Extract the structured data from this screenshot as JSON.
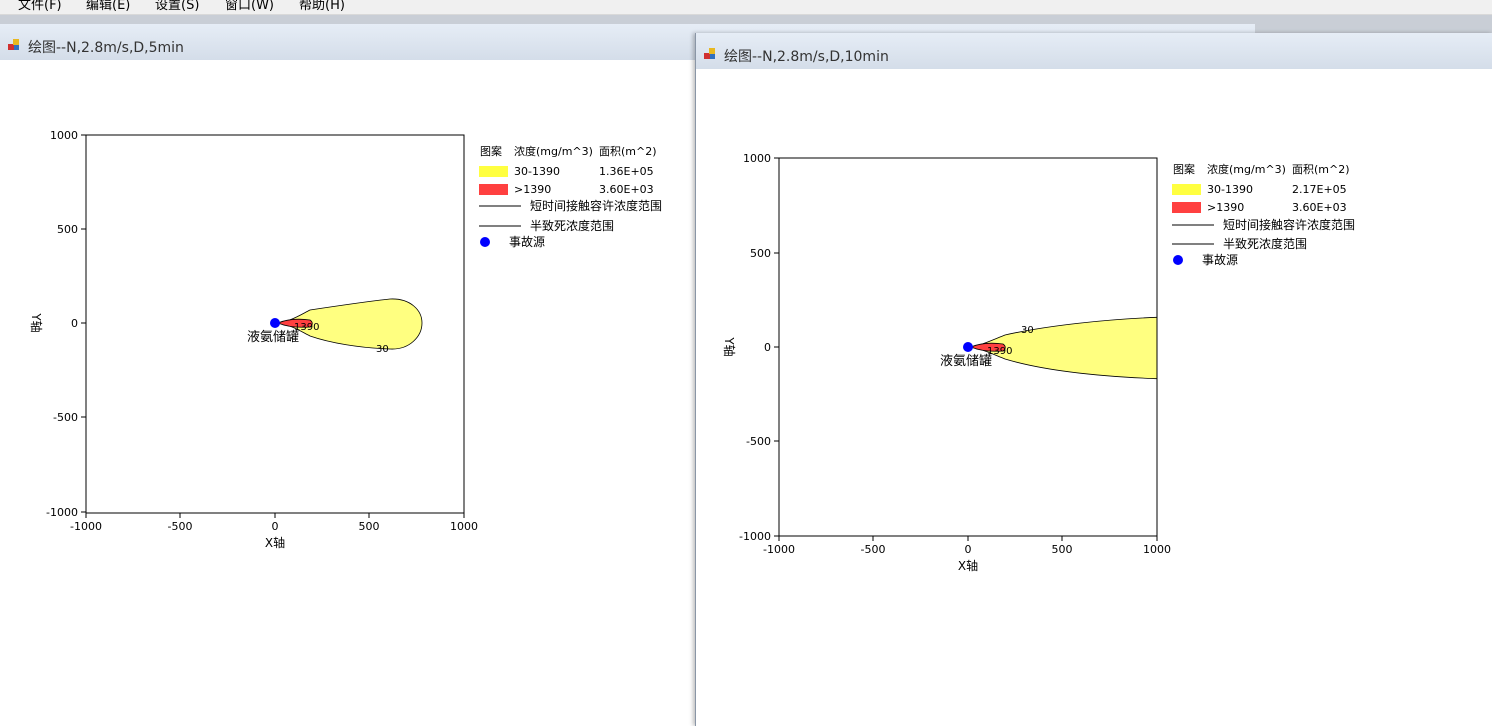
{
  "menu": {
    "items": [
      "文件(F)",
      "编辑(E)",
      "设置(S)",
      "窗口(W)",
      "帮助(H)"
    ]
  },
  "windows": [
    {
      "title": "绘图--N,2.8m/s,D,5min",
      "legend": {
        "header_pattern": "图案",
        "header_conc": "浓度(mg/m^3)",
        "header_area": "面积(m^2)",
        "row1_range": "30-1390",
        "row1_area": "1.36E+05",
        "row2_range": ">1390",
        "row2_area": "3.60E+03",
        "line1": "短时间接触容许浓度范围",
        "line2": "半致死浓度范围",
        "point": "事故源"
      },
      "xlabel": "X轴",
      "ylabel": "Y轴",
      "source_label": "液氨储罐",
      "contour_low": "30",
      "contour_high": "1390"
    },
    {
      "title": "绘图--N,2.8m/s,D,10min",
      "legend": {
        "header_pattern": "图案",
        "header_conc": "浓度(mg/m^3)",
        "header_area": "面积(m^2)",
        "row1_range": "30-1390",
        "row1_area": "2.17E+05",
        "row2_range": ">1390",
        "row2_area": "3.60E+03",
        "line1": "短时间接触容许浓度范围",
        "line2": "半致死浓度范围",
        "point": "事故源"
      },
      "xlabel": "X轴",
      "ylabel": "Y轴",
      "source_label": "液氨储罐",
      "contour_low": "30",
      "contour_high": "1390"
    }
  ],
  "axis_ticks": {
    "x": [
      "-1000",
      "-500",
      "0",
      "500",
      "1000"
    ],
    "y": [
      "1000",
      "500",
      "0",
      "-500",
      "-1000"
    ]
  },
  "colors": {
    "yellow_zone": "#ffff80",
    "legend_yellow": "#ffff40",
    "red_zone": "#ff4040",
    "source_point": "#0000ff"
  },
  "chart_data": [
    {
      "type": "area",
      "title": "绘图--N,2.8m/s,D,5min",
      "xlabel": "X轴",
      "ylabel": "Y轴",
      "xlim": [
        -1000,
        1000
      ],
      "ylim": [
        -1000,
        1000
      ],
      "zones": [
        {
          "name": "30-1390",
          "x_extent": [
            0,
            780
          ],
          "max_half_width": 130
        },
        {
          "name": ">1390",
          "x_extent": [
            0,
            150
          ],
          "max_half_width": 20
        }
      ],
      "source": {
        "x": 0,
        "y": 0,
        "label": "液氨储罐"
      }
    },
    {
      "type": "area",
      "title": "绘图--N,2.8m/s,D,10min",
      "xlabel": "X轴",
      "ylabel": "Y轴",
      "xlim": [
        -1000,
        1000
      ],
      "ylim": [
        -1000,
        1000
      ],
      "zones": [
        {
          "name": "30-1390",
          "x_extent": [
            0,
            1000
          ],
          "max_half_width": 160
        },
        {
          "name": ">1390",
          "x_extent": [
            0,
            150
          ],
          "max_half_width": 20
        }
      ],
      "source": {
        "x": 0,
        "y": 0,
        "label": "液氨储罐"
      }
    }
  ]
}
